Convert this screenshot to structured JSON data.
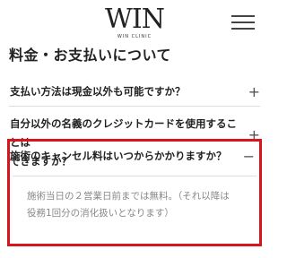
{
  "header": {
    "logo_main": "WIN",
    "logo_sub": "WIN CLINIC"
  },
  "page": {
    "title": "料金・お支払いについて"
  },
  "faq": [
    {
      "question": "支払い方法は現金以外も可能ですか？",
      "toggle": "+"
    },
    {
      "question_line1": "自分以外の名義のクレジットカードを使用することは",
      "question_line2": "できますか？",
      "toggle": "+"
    },
    {
      "question": "施術のキャンセル料はいつからかかりますか？",
      "toggle": "−",
      "answer_line1": "施術当日の２営業日前までは無料。（それ以降は",
      "answer_line2": "役務1回分の消化扱いとなります）"
    }
  ]
}
